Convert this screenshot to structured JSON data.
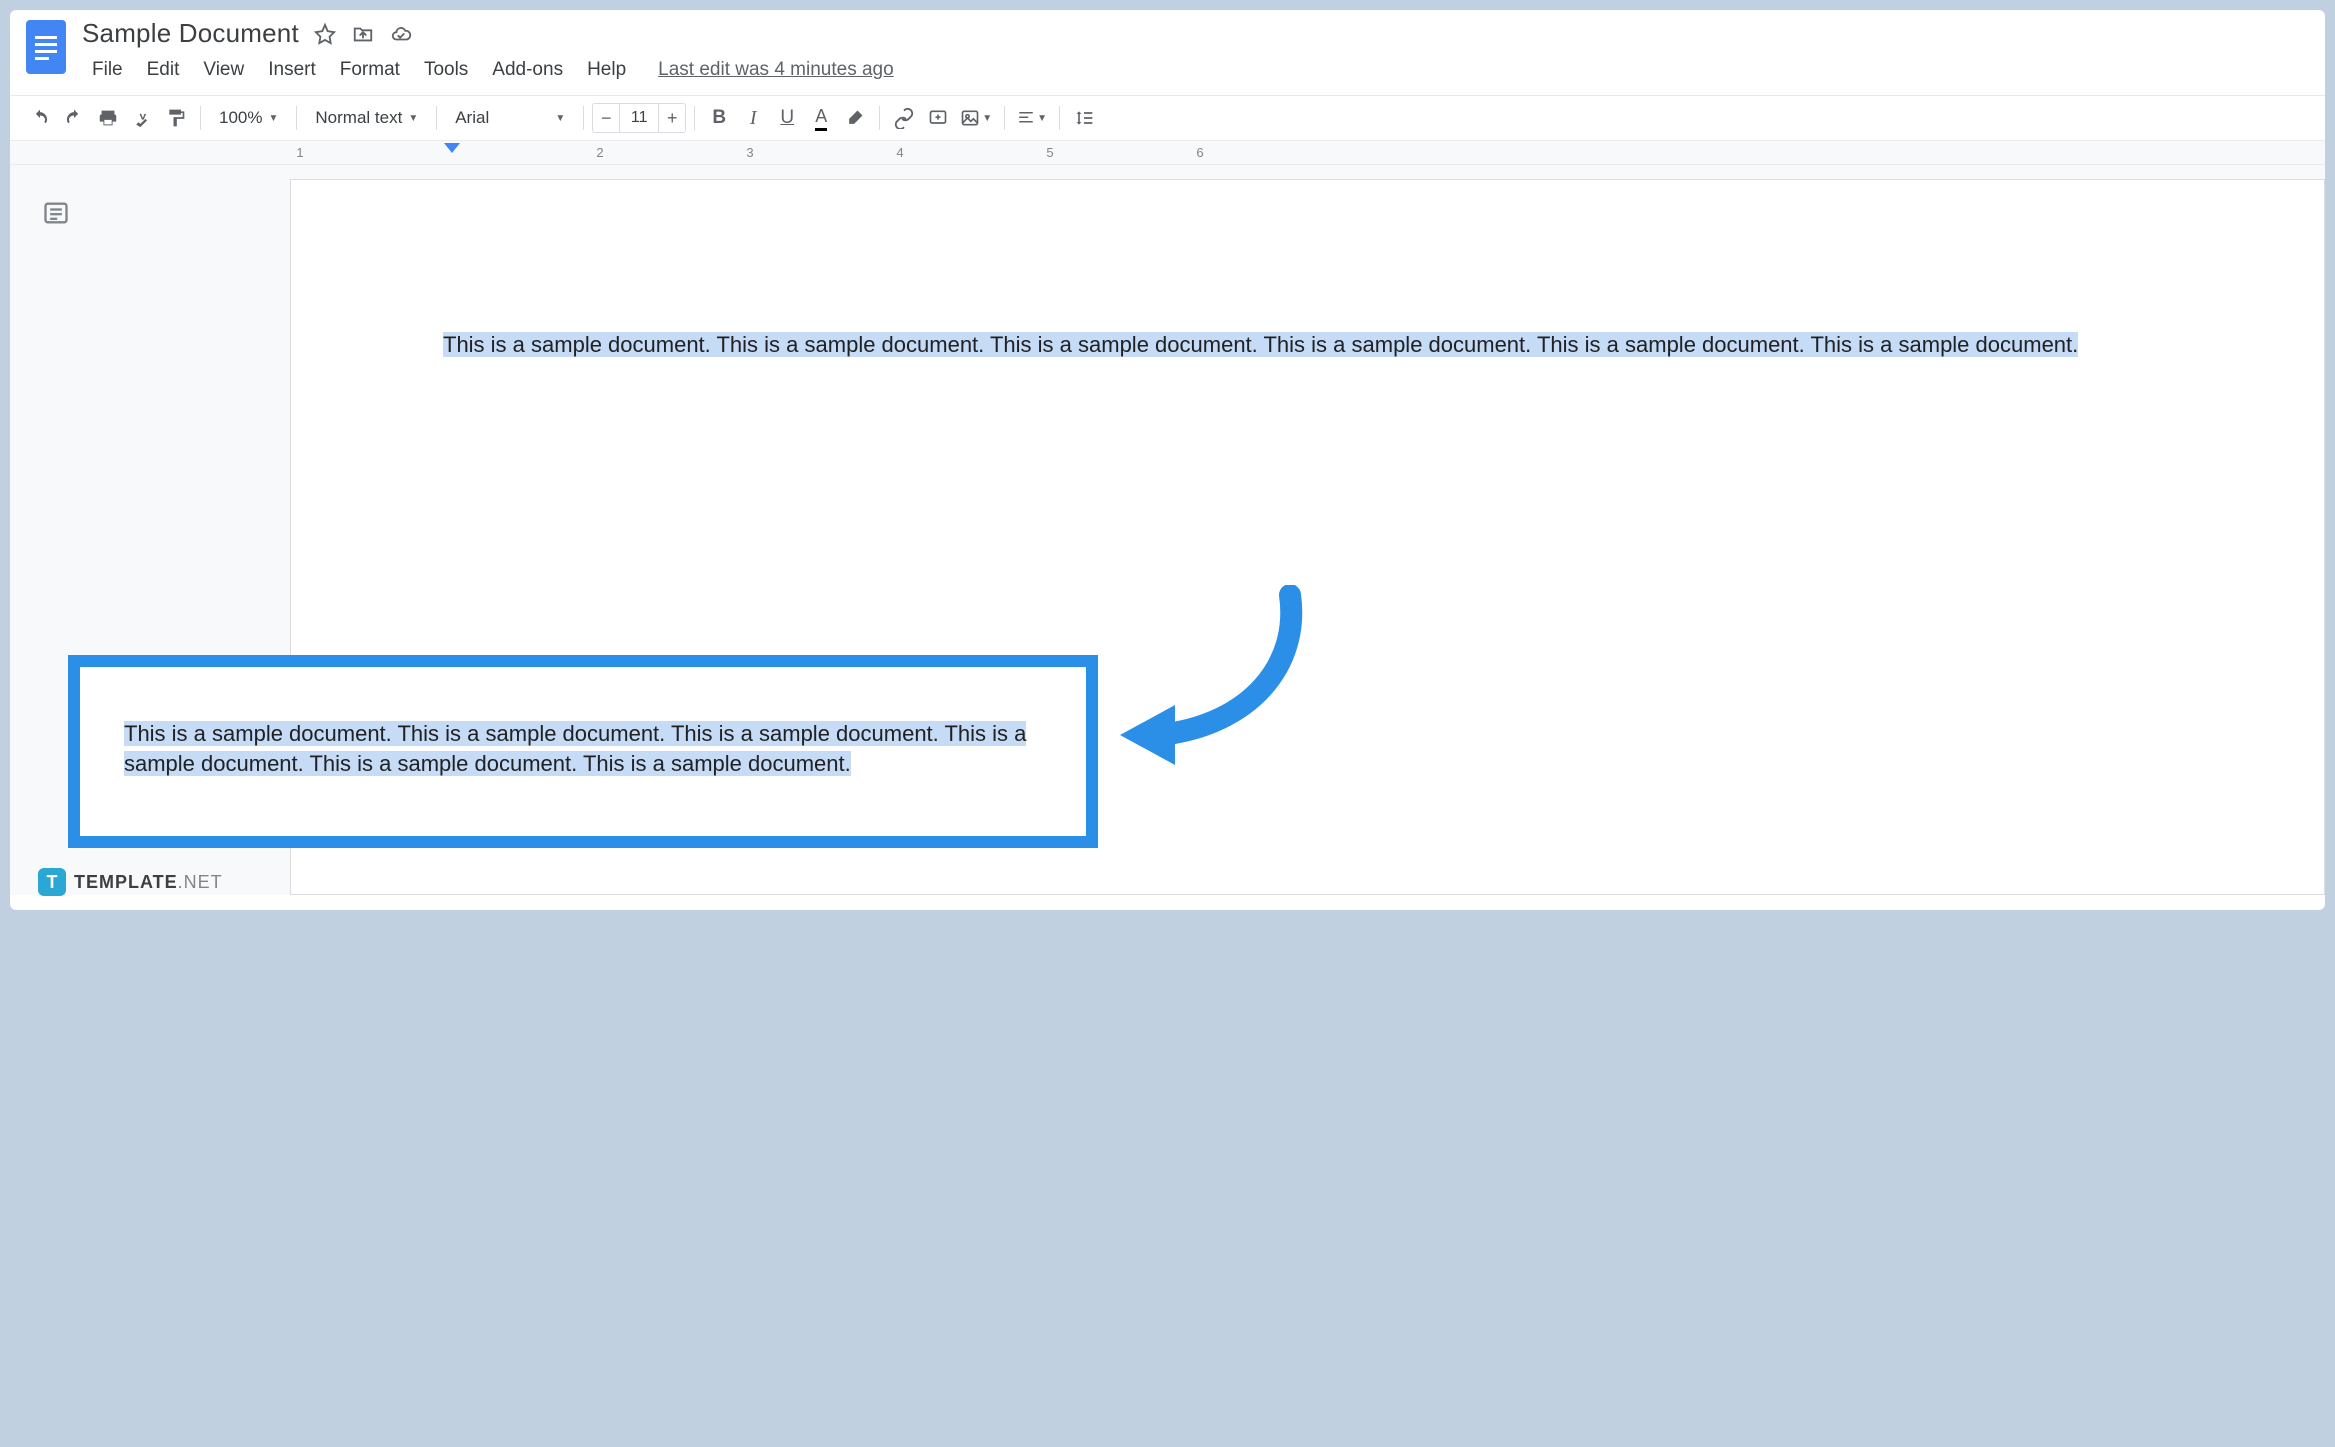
{
  "header": {
    "title": "Sample Document",
    "last_edit": "Last edit was 4 minutes ago"
  },
  "menus": [
    "File",
    "Edit",
    "View",
    "Insert",
    "Format",
    "Tools",
    "Add-ons",
    "Help"
  ],
  "toolbar": {
    "zoom": "100%",
    "style": "Normal text",
    "font": "Arial",
    "font_size": "11"
  },
  "ruler": [
    "1",
    "2",
    "3",
    "4",
    "5",
    "6"
  ],
  "document": {
    "paragraph": "This is a sample document. This is a sample document. This is a sample document. This is a sample document. This is a sample document. This is a sample document."
  },
  "callout": {
    "paragraph": "This is a sample document. This is a sample document. This is a sample document. This is a sample document. This is a sample document. This is a sample document."
  },
  "footer": {
    "brand": "TEMPLATE",
    "tld": ".NET"
  }
}
